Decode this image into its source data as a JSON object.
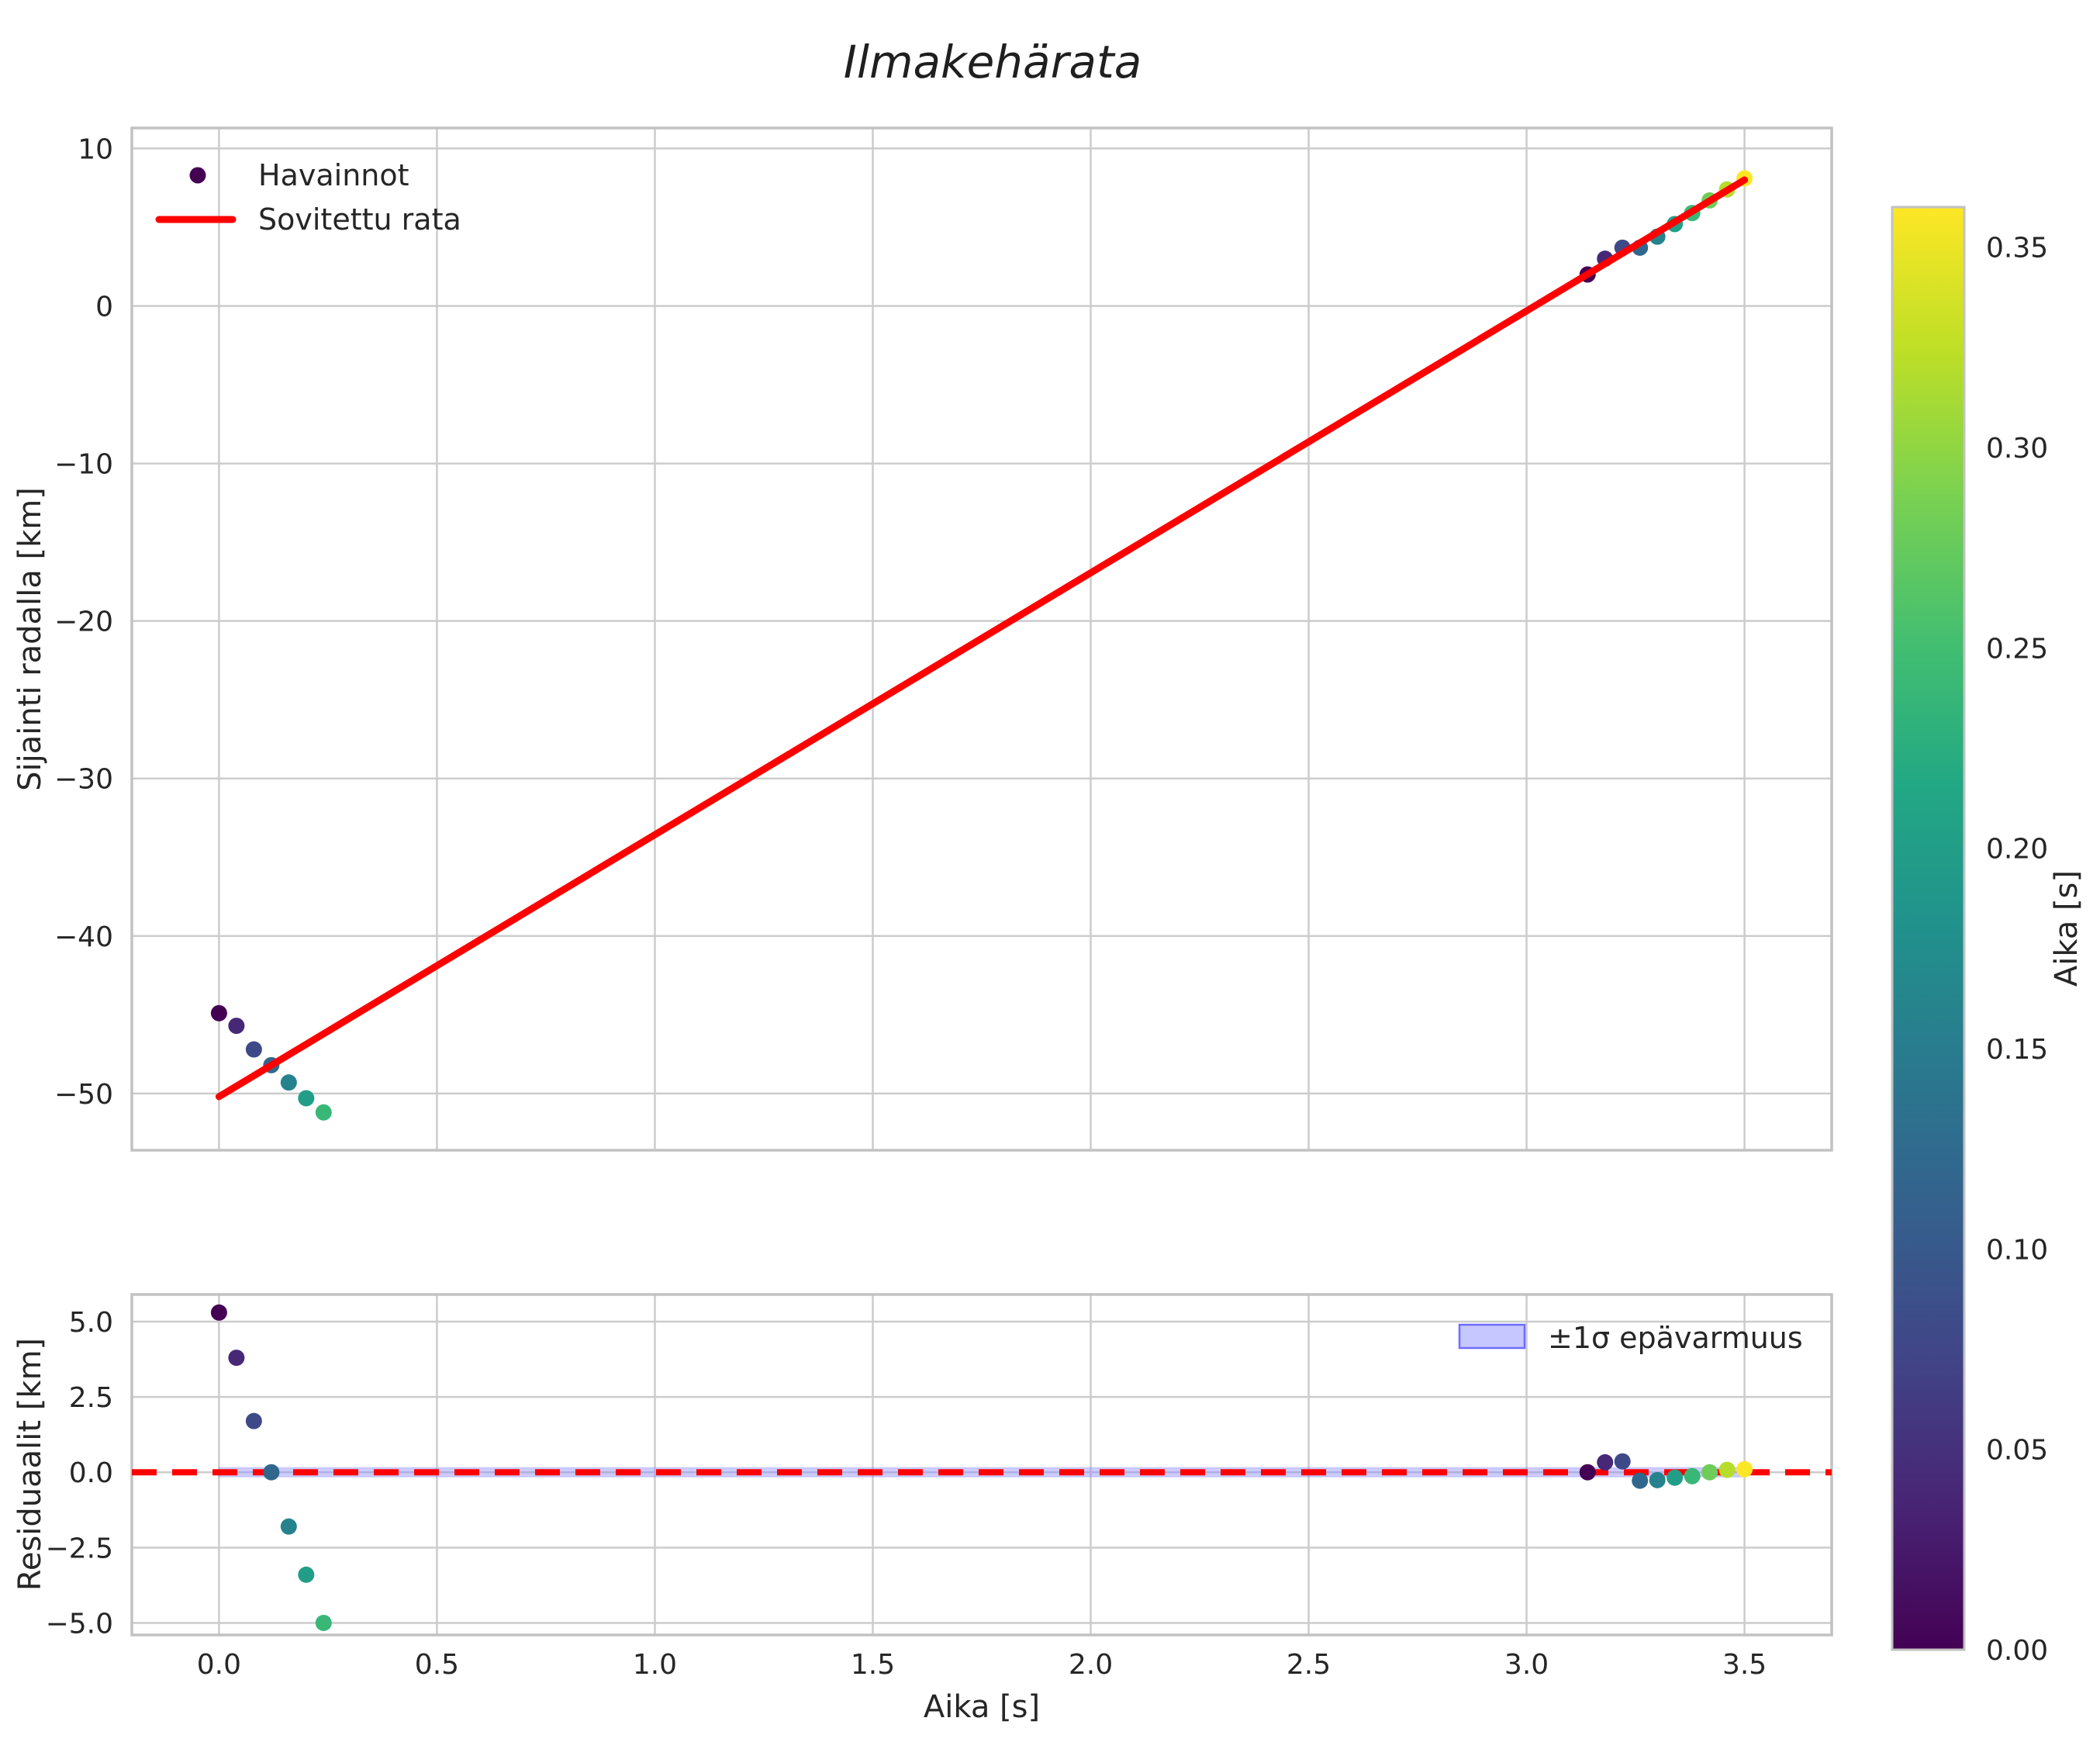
{
  "title": "Ilmakehärata",
  "colors": {
    "background": "#ffffff",
    "grid": "#cccccc",
    "spine": "#c2c2c2",
    "text": "#262626",
    "fit_line": "#ff0000",
    "zero_line": "#ff0000",
    "band_fill": "#9090ff",
    "band_edge": "#6d6dff",
    "legend_dot": "#440154"
  },
  "colorbar": {
    "label": "Aika [s]",
    "colormap": "viridis",
    "vmin": 0.0,
    "vmax": 0.36,
    "tick_values": [
      0.0,
      0.05,
      0.1,
      0.15,
      0.2,
      0.25,
      0.3,
      0.35
    ],
    "tick_labels": [
      "0.00",
      "0.05",
      "0.10",
      "0.15",
      "0.20",
      "0.25",
      "0.30",
      "0.35"
    ]
  },
  "chart_data": [
    {
      "id": "trajectory",
      "type": "scatter",
      "title": "Ilmakehärata",
      "xlabel": "",
      "ylabel": "Sijainti radalla [km]",
      "xlim": [
        -0.2,
        3.7
      ],
      "ylim": [
        -53.6,
        11.3
      ],
      "grid": true,
      "xtick_values": [
        0.0,
        0.5,
        1.0,
        1.5,
        2.0,
        2.5,
        3.0,
        3.5
      ],
      "xtick_labels": [],
      "ytick_values": [
        10,
        0,
        -10,
        -20,
        -30,
        -40,
        -50
      ],
      "ytick_labels": [
        "10",
        "0",
        "−10",
        "−20",
        "−30",
        "−40",
        "−50"
      ],
      "legend": [
        {
          "label": "Havainnot",
          "marker": "point"
        },
        {
          "label": "Sovitettu rata",
          "marker": "line"
        }
      ],
      "series": [
        {
          "name": "Havainnot",
          "type": "scatter",
          "x": [
            0.0,
            0.04,
            0.08,
            0.12,
            0.16,
            0.2,
            0.24,
            3.14,
            3.18,
            3.22,
            3.26,
            3.3,
            3.34,
            3.38,
            3.42,
            3.46,
            3.5
          ],
          "y": [
            -44.9,
            -45.7,
            -47.2,
            -48.2,
            -49.3,
            -50.3,
            -51.2,
            2.0,
            3.0,
            3.7,
            3.7,
            4.4,
            5.2,
            5.9,
            6.7,
            7.4,
            8.1
          ],
          "color_values": [
            0.0,
            0.04,
            0.08,
            0.12,
            0.16,
            0.2,
            0.24,
            0.0,
            0.04,
            0.08,
            0.12,
            0.16,
            0.2,
            0.24,
            0.28,
            0.32,
            0.36
          ]
        },
        {
          "name": "Sovitettu rata",
          "type": "line",
          "x": [
            0.0,
            3.5
          ],
          "y": [
            -50.2,
            8.0
          ]
        }
      ]
    },
    {
      "id": "residuals",
      "type": "scatter",
      "xlabel": "Aika [s]",
      "ylabel": "Residuaalit [km]",
      "xlim": [
        -0.2,
        3.7
      ],
      "ylim": [
        -5.4,
        5.9
      ],
      "grid": true,
      "xtick_values": [
        0.0,
        0.5,
        1.0,
        1.5,
        2.0,
        2.5,
        3.0,
        3.5
      ],
      "xtick_labels": [
        "0.0",
        "0.5",
        "1.0",
        "1.5",
        "2.0",
        "2.5",
        "3.0",
        "3.5"
      ],
      "ytick_values": [
        5.0,
        2.5,
        0.0,
        -2.5,
        -5.0
      ],
      "ytick_labels": [
        "5.0",
        "2.5",
        "0.0",
        "−2.5",
        "−5.0"
      ],
      "legend": [
        {
          "label": "±1σ epävarmuus",
          "marker": "patch"
        }
      ],
      "zero_line": {
        "y": 0.0,
        "style": "dashed"
      },
      "band": {
        "x_start": 0.0,
        "x_end": 3.5,
        "y_center": 0.0,
        "half_width": 0.15
      },
      "series": [
        {
          "name": "Residuaalit",
          "type": "scatter",
          "x": [
            0.0,
            0.04,
            0.08,
            0.12,
            0.16,
            0.2,
            0.24,
            3.14,
            3.18,
            3.22,
            3.26,
            3.3,
            3.34,
            3.38,
            3.42,
            3.46,
            3.5
          ],
          "y": [
            5.3,
            3.8,
            1.7,
            0.0,
            -1.8,
            -3.4,
            -5.0,
            0.0,
            0.33,
            0.36,
            -0.28,
            -0.26,
            -0.18,
            -0.13,
            0.0,
            0.08,
            0.1
          ],
          "color_values": [
            0.0,
            0.04,
            0.08,
            0.12,
            0.16,
            0.2,
            0.24,
            0.0,
            0.04,
            0.08,
            0.12,
            0.16,
            0.2,
            0.24,
            0.28,
            0.32,
            0.36
          ]
        }
      ]
    }
  ]
}
